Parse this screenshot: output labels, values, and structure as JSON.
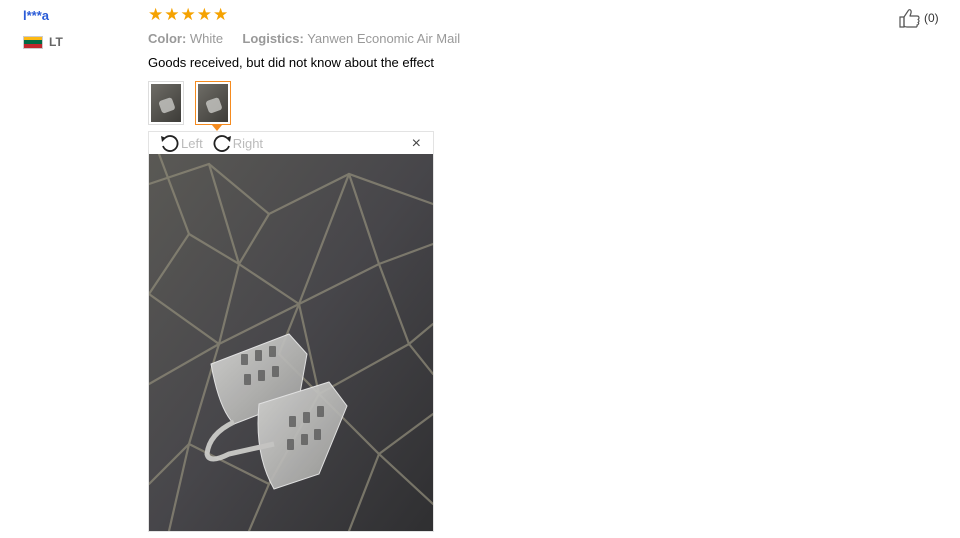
{
  "reviewer": {
    "name": "l***a",
    "country_code": "LT",
    "flag_colors": [
      "#fdb913",
      "#006a44",
      "#c1272d"
    ]
  },
  "rating": {
    "stars": 5,
    "max": 5,
    "star_color": "#f5a200"
  },
  "helpful": {
    "icon": "thumbs-up-icon",
    "count_label": "(0)"
  },
  "meta": {
    "color_label": "Color:",
    "color_value": "White",
    "logistics_label": "Logistics:",
    "logistics_value": "Yanwen Economic Air Mail"
  },
  "review_text": "Goods received, but did not know about the effect",
  "thumbnails": [
    {
      "selected": false
    },
    {
      "selected": true
    }
  ],
  "viewer": {
    "rotate_left_label": "Left",
    "rotate_right_label": "Right",
    "close_glyph": "×"
  },
  "colors": {
    "accent": "#f58b1f",
    "username": "#2a5bd7"
  }
}
